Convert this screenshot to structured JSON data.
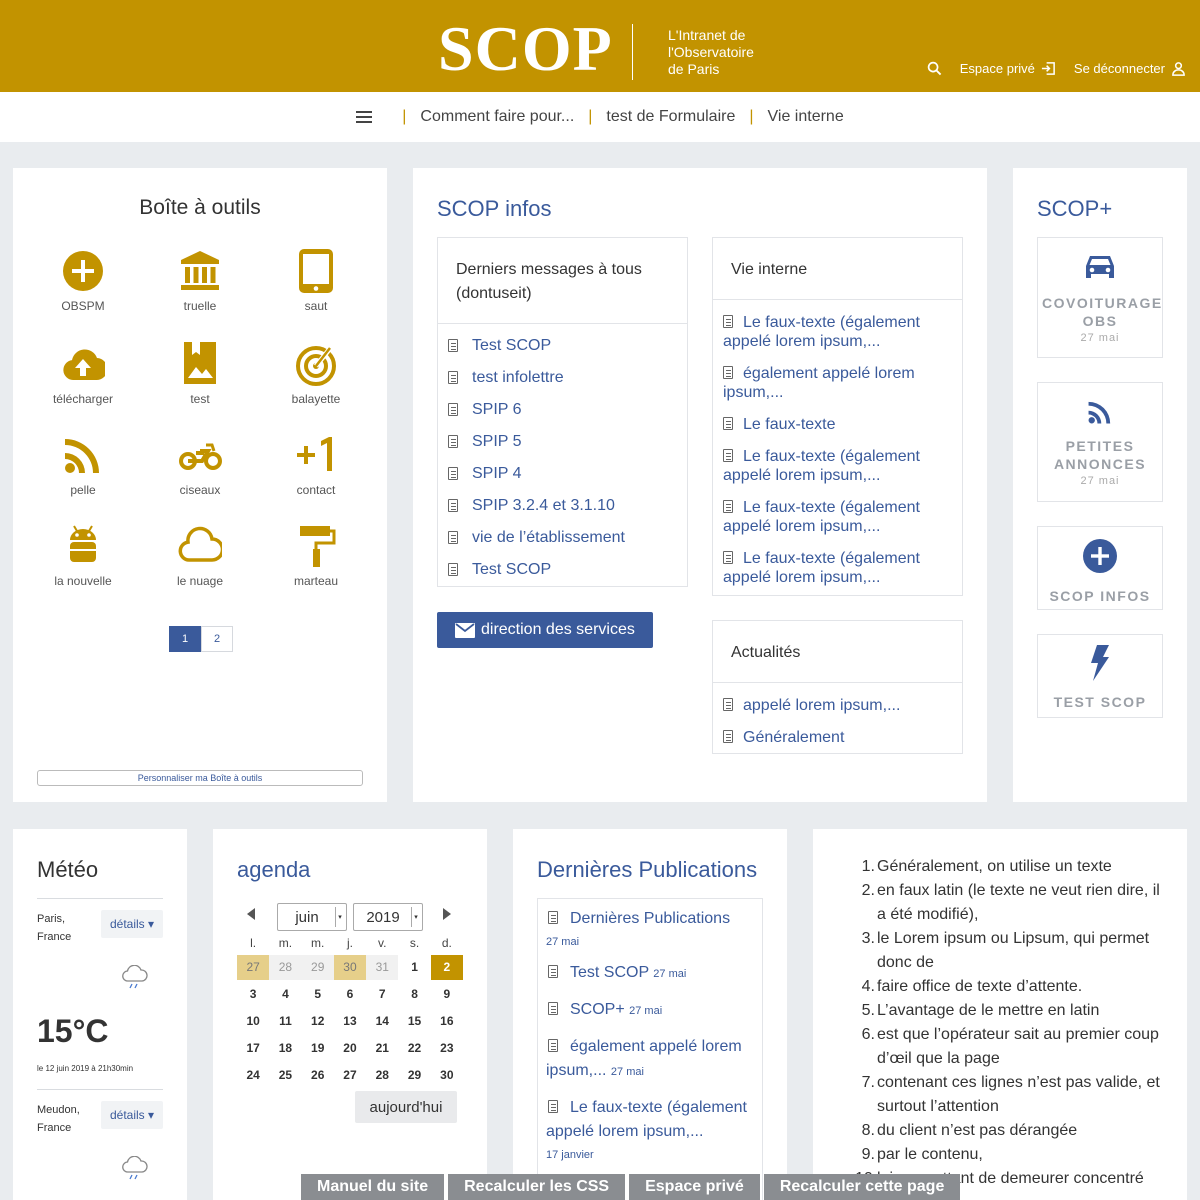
{
  "header": {
    "logo": "SCOP",
    "tagline": [
      "L'Intranet de",
      "l'Observatoire",
      "de Paris"
    ],
    "espace_prive": "Espace privé",
    "logout": "Se déconnecter"
  },
  "nav": {
    "items": [
      "Comment faire pour...",
      "test de Formulaire",
      "Vie interne"
    ]
  },
  "toolbox": {
    "title": "Boîte à outils",
    "tools": [
      {
        "label": "OBSPM",
        "icon": "plus-circle-icon"
      },
      {
        "label": "truelle",
        "icon": "bank-icon"
      },
      {
        "label": "saut",
        "icon": "tablet-icon"
      },
      {
        "label": "télécharger",
        "icon": "cloud-upload-icon"
      },
      {
        "label": "test",
        "icon": "image-bookmark-icon"
      },
      {
        "label": "balayette",
        "icon": "target-icon"
      },
      {
        "label": "pelle",
        "icon": "rss-icon"
      },
      {
        "label": "ciseaux",
        "icon": "motorcycle-icon"
      },
      {
        "label": "contact",
        "icon": "plus-one-icon"
      },
      {
        "label": "la nouvelle",
        "icon": "android-icon"
      },
      {
        "label": "le nuage",
        "icon": "cloud-icon"
      },
      {
        "label": "marteau",
        "icon": "paint-roller-icon"
      }
    ],
    "pages": [
      "1",
      "2"
    ],
    "customize": "Personnaliser ma Boîte à outils"
  },
  "scop_infos": {
    "title": "SCOP infos",
    "messages": {
      "head": "Derniers messages à tous (dontuseit)",
      "items": [
        "Test SCOP",
        "test infolettre",
        "SPIP 6",
        "SPIP 5",
        "SPIP 4",
        "SPIP 3.2.4 et 3.1.10",
        "vie de l’établissement",
        "Test SCOP"
      ]
    },
    "vie_interne": {
      "head": "Vie interne",
      "items": [
        "Le faux-texte (également appelé lorem ipsum,...",
        "également appelé lorem ipsum,...",
        "Le faux-texte",
        "Le faux-texte (également appelé lorem ipsum,...",
        "Le faux-texte (également appelé lorem ipsum,...",
        "Le faux-texte (également appelé lorem ipsum,..."
      ]
    },
    "actualites": {
      "head": "Actualités",
      "items": [
        "appelé lorem ipsum,...",
        "Généralement"
      ]
    },
    "direction_button": "direction des services"
  },
  "scop_plus": {
    "title": "SCOP+",
    "cards": [
      {
        "label": "COVOITURAGE OBS",
        "date": "27 mai",
        "icon": "car-icon"
      },
      {
        "label": "PETITES ANNONCES",
        "date": "27 mai",
        "icon": "rss-icon"
      },
      {
        "label": "SCOP INFOS",
        "date": "",
        "icon": "plus-circle-icon"
      },
      {
        "label": "TEST SCOP",
        "date": "",
        "icon": "lightning-icon"
      }
    ]
  },
  "meteo": {
    "title": "Météo",
    "city1": "Paris, France",
    "details": "détails",
    "temp": "15°C",
    "updated": "le 12 juin 2019 à 21h30min",
    "city2": "Meudon, France"
  },
  "agenda": {
    "title": "agenda",
    "month": "juin",
    "year": "2019",
    "weekdays": [
      "l.",
      "m.",
      "m.",
      "j.",
      "v.",
      "s.",
      "d."
    ],
    "weeks": [
      [
        "27",
        "28",
        "29",
        "30",
        "31",
        "1",
        "2"
      ],
      [
        "3",
        "4",
        "5",
        "6",
        "7",
        "8",
        "9"
      ],
      [
        "10",
        "11",
        "12",
        "13",
        "14",
        "15",
        "16"
      ],
      [
        "17",
        "18",
        "19",
        "20",
        "21",
        "22",
        "23"
      ],
      [
        "24",
        "25",
        "26",
        "27",
        "28",
        "29",
        "30"
      ]
    ],
    "today_label": "aujourd'hui"
  },
  "publications": {
    "title": "Dernières Publications",
    "items": [
      {
        "text": "Dernières Publications",
        "date": "27 mai"
      },
      {
        "text": "Test SCOP",
        "date": "27 mai"
      },
      {
        "text": "SCOP+",
        "date": "27 mai"
      },
      {
        "text": "également appelé lorem ipsum,...",
        "date": "27 mai"
      },
      {
        "text": "Le faux-texte (également appelé lorem ipsum,...",
        "date": "17 janvier"
      }
    ]
  },
  "lorem_list": [
    "Généralement, on utilise un texte",
    "en faux latin (le texte ne veut rien dire, il a été modifié),",
    "le Lorem ipsum ou Lipsum, qui permet donc de",
    "faire office de texte d’attente.",
    "L’avantage de le mettre en latin",
    "est que l’opérateur sait au premier coup d’œil que la page",
    "contenant ces lignes n’est pas valide, et surtout l’attention",
    "du client n’est pas dérangée",
    "par le contenu,",
    "lui permettant de demeurer concentré"
  ],
  "adminbar": [
    "Manuel du site",
    "Recalculer les CSS",
    "Espace privé",
    "Recalculer cette page"
  ],
  "colors": {
    "brand": "#c29300",
    "link": "#3a5a9b",
    "background": "#e9ecef"
  }
}
